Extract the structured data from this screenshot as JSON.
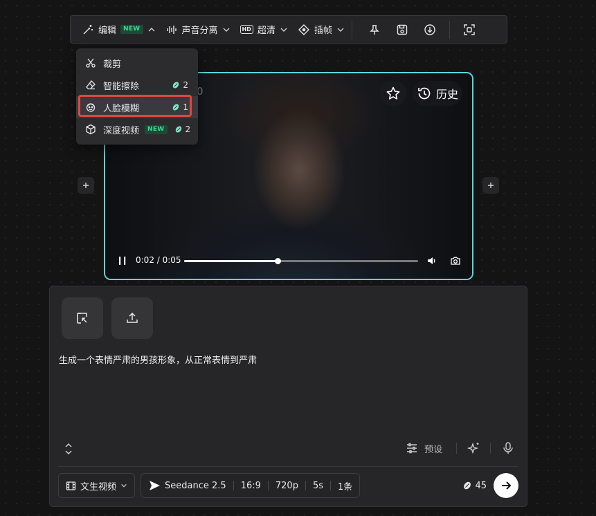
{
  "toolbar": {
    "edit_label": "编辑",
    "edit_badge": "NEW",
    "audio_split_label": "声音分离",
    "hd_badge": "HD",
    "hd_label": "超清",
    "interp_label": "插帧"
  },
  "dropdown": {
    "items": [
      {
        "label": "裁剪",
        "icon": "scissors-icon"
      },
      {
        "label": "智能擦除",
        "icon": "eraser-icon",
        "cost": "2"
      },
      {
        "label": "人脸模糊",
        "icon": "face-icon",
        "cost": "1",
        "highlighted": true
      },
      {
        "label": "深度视频",
        "icon": "cube-icon",
        "badge": "NEW",
        "cost": "2"
      }
    ]
  },
  "ghost": {
    "a": "10",
    "b": "0"
  },
  "video": {
    "history_label": "历史",
    "time": "0:02 / 0:05",
    "progress": 0.4
  },
  "composer": {
    "prompt": "生成一个表情严肃的男孩形象，从正常表情到严肃",
    "preset_label": "预设",
    "mode_label": "文生视频",
    "model": "Seedance 2.5",
    "ratio": "16:9",
    "resolution": "720p",
    "duration": "5s",
    "count": "1条",
    "credits": "45"
  },
  "colors": {
    "accent_border": "#5fd4d9",
    "highlight": "#e0473f",
    "new_badge": "#3fd78f"
  }
}
